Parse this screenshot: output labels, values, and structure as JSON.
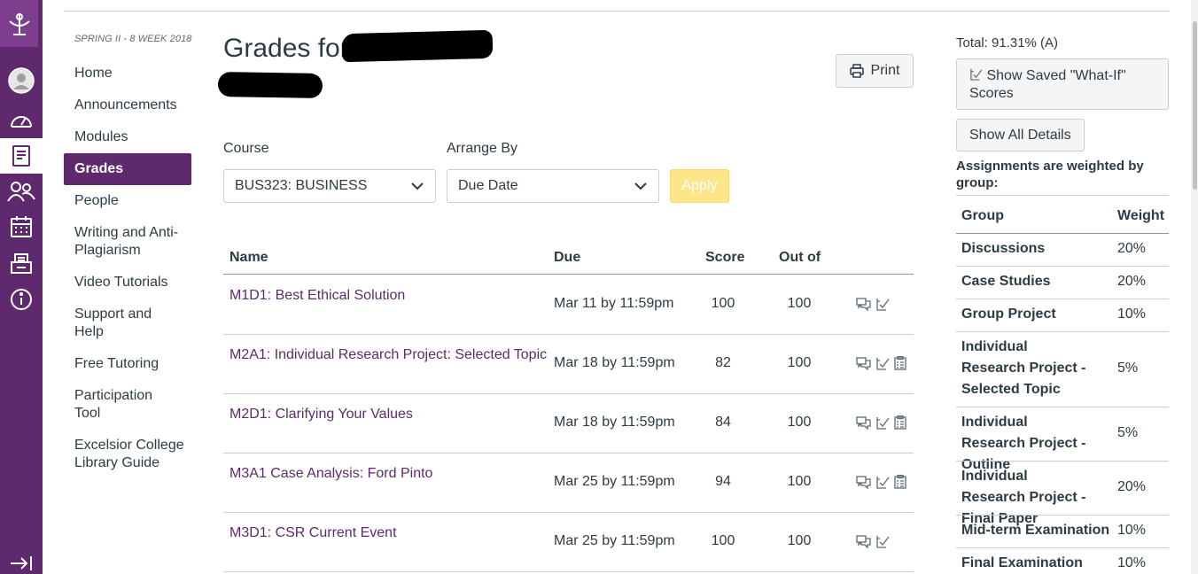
{
  "global_nav": {
    "items": [
      {
        "icon": "logo-icon"
      },
      {
        "icon": "account-avatar-icon"
      },
      {
        "icon": "dashboard-icon"
      },
      {
        "icon": "courses-icon"
      },
      {
        "icon": "groups-icon"
      },
      {
        "icon": "calendar-icon"
      },
      {
        "icon": "inbox-icon"
      },
      {
        "icon": "help-icon"
      },
      {
        "icon": "collapse-nav-icon"
      }
    ],
    "colors": {
      "background": "#5e2a6d",
      "logo_bg": "#7d3e8e"
    }
  },
  "course_nav": {
    "term": "SPRING II - 8 WEEK 2018",
    "items": [
      {
        "label": "Home"
      },
      {
        "label": "Announcements"
      },
      {
        "label": "Modules"
      },
      {
        "label": "Grades",
        "active": true
      },
      {
        "label": "People"
      },
      {
        "label": "Writing and Anti-Plagiarism"
      },
      {
        "label": "Video Tutorials"
      },
      {
        "label": "Support and Help"
      },
      {
        "label": "Free Tutoring"
      },
      {
        "label": "Participation Tool"
      },
      {
        "label": "Excelsior College Library Guide"
      }
    ]
  },
  "header": {
    "title": "Grades for",
    "print_label": "Print"
  },
  "filters": {
    "course_label": "Course",
    "course_value": "BUS323: BUSINESS",
    "arrange_label": "Arrange By",
    "arrange_value": "Due Date",
    "apply_label": "Apply"
  },
  "table": {
    "headers": {
      "name": "Name",
      "due": "Due",
      "score": "Score",
      "out_of": "Out of"
    },
    "rows": [
      {
        "name": "M1D1: Best Ethical Solution",
        "due": "Mar 11 by 11:59pm",
        "score": "100",
        "out_of": "100",
        "icons": [
          "comment-icon",
          "what-if-icon"
        ]
      },
      {
        "name": "M2A1: Individual Research Project: Selected Topic",
        "due": "Mar 18 by 11:59pm",
        "score": "82",
        "out_of": "100",
        "icons": [
          "comment-icon",
          "what-if-icon",
          "rubric-icon"
        ]
      },
      {
        "name": "M2D1: Clarifying Your Values",
        "due": "Mar 18 by 11:59pm",
        "score": "84",
        "out_of": "100",
        "icons": [
          "comment-icon",
          "what-if-icon",
          "rubric-icon"
        ]
      },
      {
        "name": "M3A1 Case Analysis: Ford Pinto",
        "due": "Mar 25 by 11:59pm",
        "score": "94",
        "out_of": "100",
        "icons": [
          "comment-icon",
          "what-if-icon",
          "rubric-icon"
        ]
      },
      {
        "name": "M3D1: CSR Current Event",
        "due": "Mar 25 by 11:59pm",
        "score": "100",
        "out_of": "100",
        "icons": [
          "comment-icon",
          "what-if-icon"
        ]
      }
    ]
  },
  "sidebar": {
    "total": "Total: 91.31% (A)",
    "saved_whatif_label": "Show Saved \"What-If\" Scores",
    "show_details_label": "Show All Details",
    "weighted_note": "Assignments are weighted by group:",
    "weights_header": {
      "group": "Group",
      "weight": "Weight"
    },
    "weights": [
      {
        "group": "Discussions",
        "weight": "20%"
      },
      {
        "group": "Case Studies",
        "weight": "20%"
      },
      {
        "group": "Group Project",
        "weight": "10%"
      },
      {
        "group": "Individual Research Project - Selected Topic",
        "weight": "5%"
      },
      {
        "group": "Individual Research Project - Outline",
        "weight": "5%"
      },
      {
        "group": "Individual Research Project - Final Paper",
        "weight": "20%"
      },
      {
        "group": "Mid-term Examination",
        "weight": "10%"
      },
      {
        "group": "Final Examination",
        "weight": "10%"
      }
    ]
  },
  "colors": {
    "link": "#5e2a6d",
    "apply_disabled": "#fde68a",
    "text": "#2d3b45"
  }
}
